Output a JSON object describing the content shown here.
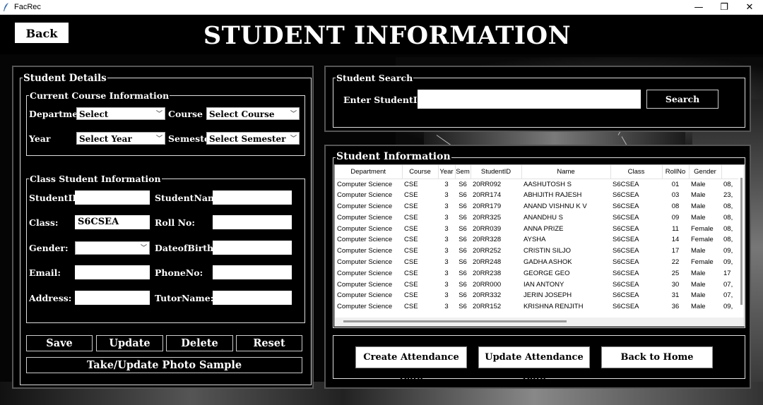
{
  "window": {
    "title": "FacRec",
    "minimize_glyph": "—",
    "maximize_glyph": "❐",
    "close_glyph": "✕",
    "icon": "feather-icon"
  },
  "header": {
    "back_label": "Back",
    "title": "STUDENT INFORMATION"
  },
  "student_details": {
    "frame_label": "Student Details",
    "course": {
      "frame_label": "Current Course Information",
      "department_label": "Department",
      "department_value": "Select Department",
      "course_label": "Course",
      "course_value": "Select Course",
      "year_label": "Year",
      "year_value": "Select Year",
      "semester_label": "Semester",
      "semester_value": "Select Semester"
    },
    "class_info": {
      "frame_label": "Class Student Information",
      "studentid_label": "StudentID:",
      "studentid_value": "",
      "studentname_label": "StudentName:",
      "studentname_value": "",
      "class_label": "Class:",
      "class_value": "S6CSEA",
      "rollno_label": "Roll No:",
      "rollno_value": "",
      "gender_label": "Gender:",
      "gender_value": "",
      "dob_label": "DateofBirth:",
      "dob_value": "",
      "email_label": "Email:",
      "email_value": "",
      "phone_label": "PhoneNo:",
      "phone_value": "",
      "address_label": "Address:",
      "address_value": "",
      "tutor_label": "TutorName:",
      "tutor_value": ""
    },
    "buttons": {
      "save": "Save",
      "update": "Update",
      "delete": "Delete",
      "reset": "Reset",
      "photo": "Take/Update Photo Sample"
    }
  },
  "search": {
    "frame_label": "Student Search",
    "label": "Enter StudentID:",
    "value": "",
    "button": "Search"
  },
  "table": {
    "frame_label": "Student Information",
    "columns": [
      "Department",
      "Course",
      "Year",
      "Sem",
      "StudentID",
      "Name",
      "Class",
      "RollNo",
      "Gender",
      ""
    ],
    "rows": [
      [
        "Computer Science",
        "CSE",
        "3",
        "S6",
        "20RR092",
        "AASHUTOSH S",
        "S6CSEA",
        "01",
        "Male",
        "08,"
      ],
      [
        "Computer Science",
        "CSE",
        "3",
        "S6",
        "20RR174",
        "ABHIJITH RAJESH",
        "S6CSEA",
        "03",
        "Male",
        "23,"
      ],
      [
        "Computer Science",
        "CSE",
        "3",
        "S6",
        "20RR179",
        "ANAND VISHNU K V",
        "S6CSEA",
        "08",
        "Male",
        "08,"
      ],
      [
        "Computer Science",
        "CSE",
        "3",
        "S6",
        "20RR325",
        "ANANDHU S",
        "S6CSEA",
        "09",
        "Male",
        "08,"
      ],
      [
        "Computer Science",
        "CSE",
        "3",
        "S6",
        "20RR039",
        "ANNA PRIZE",
        "S6CSEA",
        "11",
        "Female",
        "08,"
      ],
      [
        "Computer Science",
        "CSE",
        "3",
        "S6",
        "20RR328",
        "AYSHA",
        "S6CSEA",
        "14",
        "Female",
        "08,"
      ],
      [
        "Computer Science",
        "CSE",
        "3",
        "S6",
        "20RR252",
        "CRISTIN SILJO",
        "S6CSEA",
        "17",
        "Male",
        "09,"
      ],
      [
        "Computer Science",
        "CSE",
        "3",
        "S6",
        "20RR248",
        "GADHA ASHOK",
        "S6CSEA",
        "22",
        "Female",
        "09,"
      ],
      [
        "Computer Science",
        "CSE",
        "3",
        "S6",
        "20RR238",
        "GEORGE GEO",
        "S6CSEA",
        "25",
        "Male",
        "17"
      ],
      [
        "Computer Science",
        "CSE",
        "3",
        "S6",
        "20RR000",
        "IAN ANTONY",
        "S6CSEA",
        "30",
        "Male",
        "07,"
      ],
      [
        "Computer Science",
        "CSE",
        "3",
        "S6",
        "20RR332",
        "JERIN JOSEPH",
        "S6CSEA",
        "31",
        "Male",
        "07,"
      ],
      [
        "Computer Science",
        "CSE",
        "3",
        "S6",
        "20RR152",
        "KRISHNA RENJITH",
        "S6CSEA",
        "36",
        "Male",
        "09,"
      ]
    ]
  },
  "actions": {
    "create_attendance": "Create Attendance Data",
    "update_attendance": "Update Attendance Data",
    "back_home": "Back to Home"
  }
}
